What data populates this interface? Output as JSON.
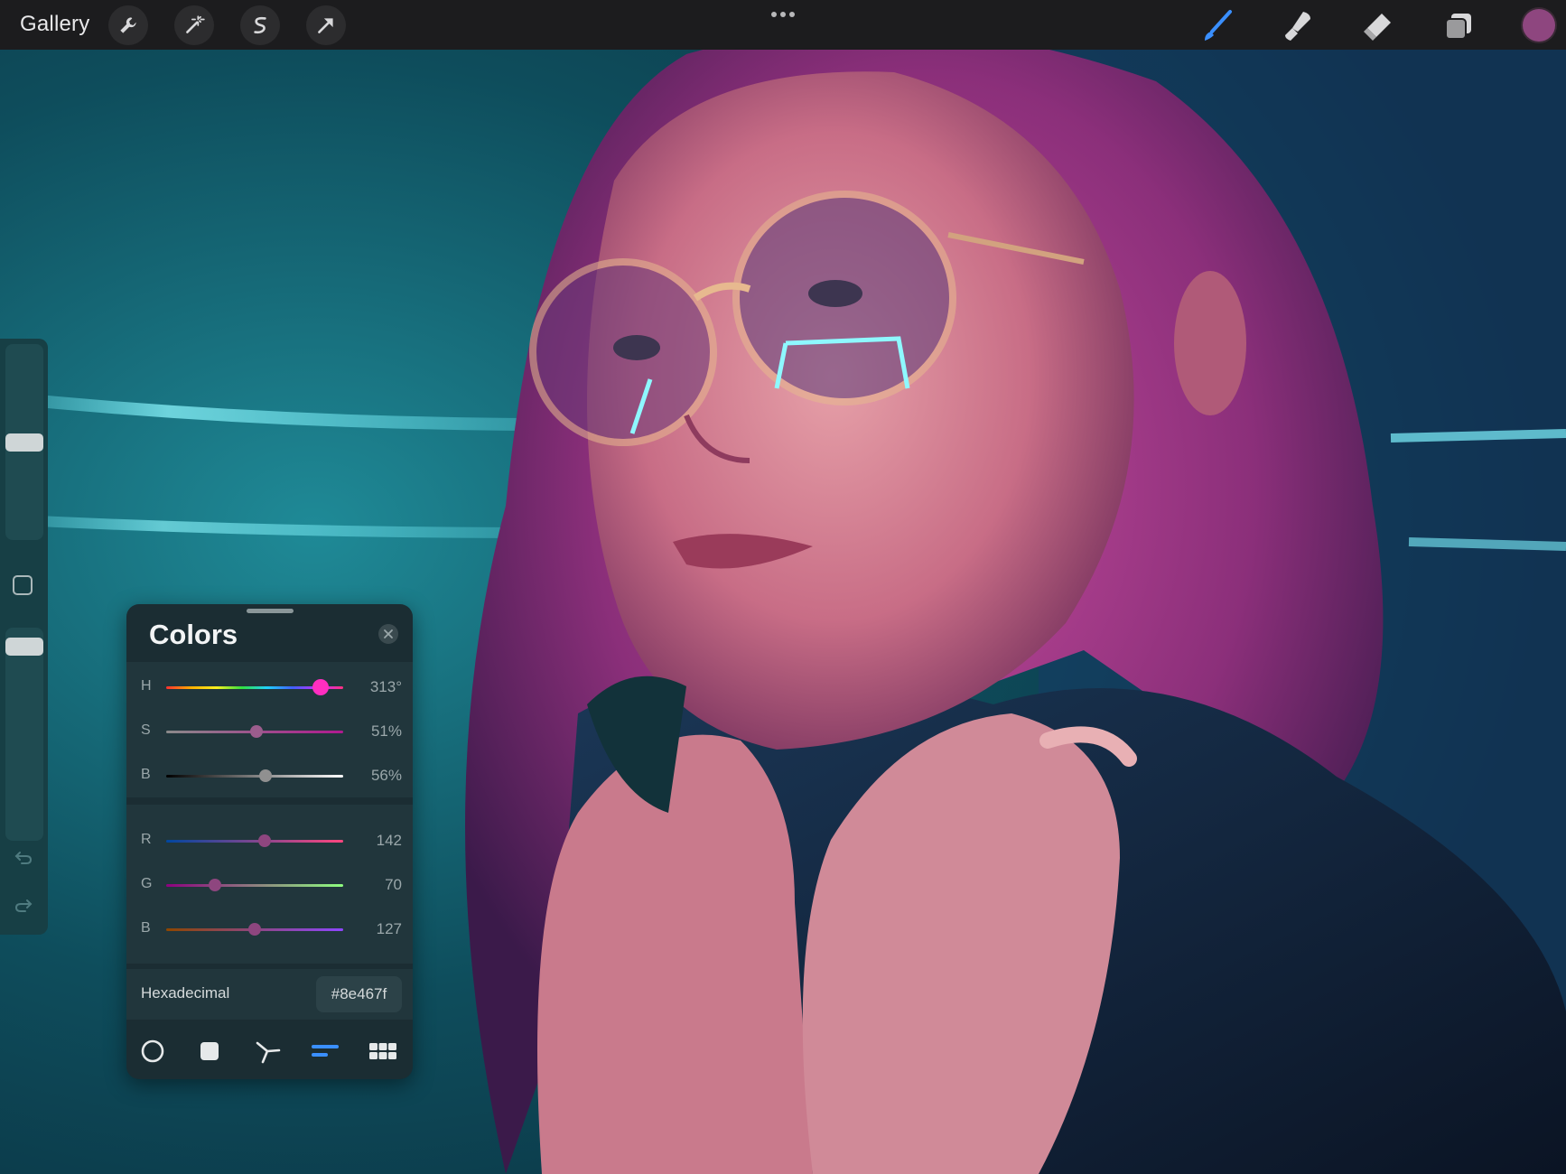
{
  "topbar": {
    "gallery_label": "Gallery",
    "left_tools": [
      "wrench-icon",
      "magic-wand-icon",
      "selection-icon",
      "transform-arrow-icon"
    ],
    "right_tools": [
      "brush-icon",
      "smudge-icon",
      "eraser-icon",
      "layers-icon"
    ],
    "current_color": "#8e467f"
  },
  "sidebar": {
    "brush_size_level": 0.5,
    "opacity_level": 0.95
  },
  "colors_panel": {
    "title": "Colors",
    "hsb": [
      {
        "label": "H",
        "value": "313°",
        "fraction": 0.87
      },
      {
        "label": "S",
        "value": "51%",
        "fraction": 0.51
      },
      {
        "label": "B",
        "value": "56%",
        "fraction": 0.56
      }
    ],
    "rgb": [
      {
        "label": "R",
        "value": "142",
        "fraction": 0.557
      },
      {
        "label": "G",
        "value": "70",
        "fraction": 0.275
      },
      {
        "label": "B",
        "value": "127",
        "fraction": 0.498
      }
    ],
    "hex_label": "Hexadecimal",
    "hex_value": "#8e467f",
    "modes": [
      "disc-icon",
      "classic-square-icon",
      "harmony-icon",
      "value-sliders-icon",
      "palettes-grid-icon"
    ],
    "active_mode": "value-sliders-icon",
    "accent": "#3a8fff"
  }
}
